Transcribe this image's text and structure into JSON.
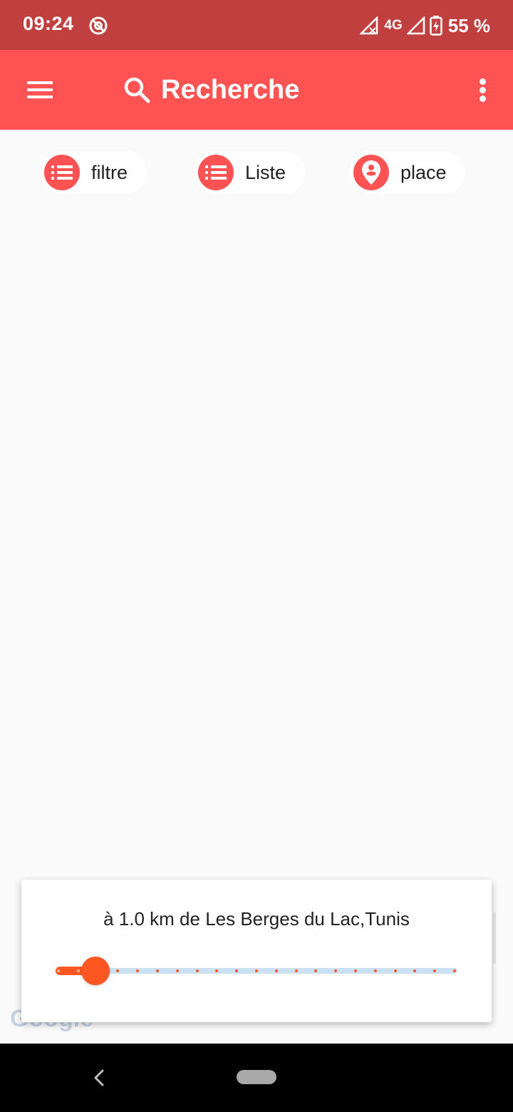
{
  "status_bar": {
    "time": "09:24",
    "network": "4G",
    "battery": "55 %"
  },
  "app_bar": {
    "title": "Recherche"
  },
  "chips": [
    {
      "label": "filtre",
      "icon": "list-icon"
    },
    {
      "label": "Liste",
      "icon": "list-icon"
    },
    {
      "label": "place",
      "icon": "place-icon"
    }
  ],
  "map": {
    "attribution": "Google"
  },
  "radius_card": {
    "text": "à 1.0 km de Les Berges du Lac,Tunis",
    "slider_fraction": 0.1
  },
  "colors": {
    "status_bar": "#c0403f",
    "app_bar": "#ff5252",
    "accent": "#ff5722",
    "track": "#c9e1f3"
  }
}
